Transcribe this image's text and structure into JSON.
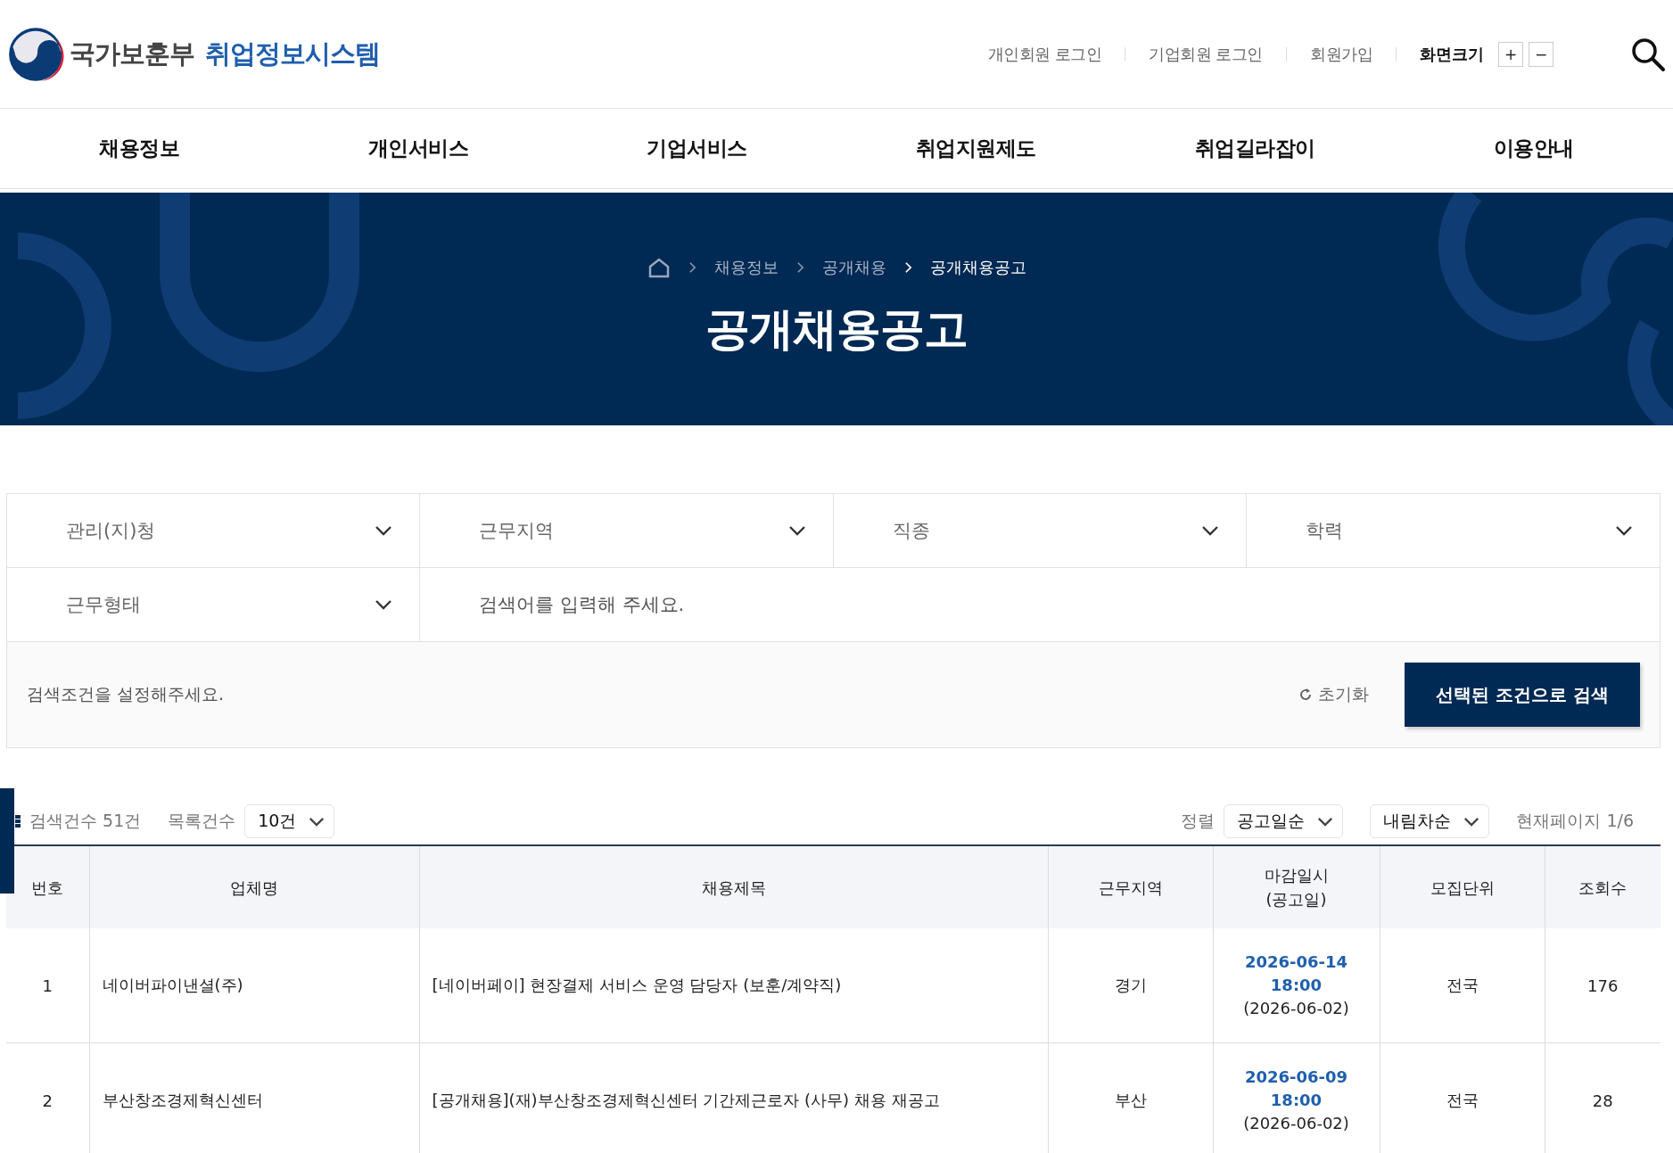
{
  "header": {
    "logo_primary": "국가보훈부",
    "logo_secondary": "취업정보시스템",
    "links": [
      "개인회원 로그인",
      "기업회원 로그인",
      "회원가입"
    ],
    "font_size": {
      "label": "화면크기",
      "increase": "+",
      "decrease": "−"
    }
  },
  "nav": [
    {
      "label": "채용정보",
      "selected": false
    },
    {
      "label": "개인서비스",
      "selected": false
    },
    {
      "label": "기업서비스",
      "selected": false
    },
    {
      "label": "취업지원제도",
      "selected": false
    },
    {
      "label": "취업길라잡이",
      "selected": false
    },
    {
      "label": "이용안내",
      "selected": false
    }
  ],
  "banner": {
    "breadcrumb": [
      "채용정보",
      "공개채용"
    ],
    "current": "공개채용공고",
    "title": "공개채용공고"
  },
  "filters": [
    {
      "kind": "select",
      "label": "관리(지)청"
    },
    {
      "kind": "select",
      "label": "근무지역"
    },
    {
      "kind": "select",
      "label": "직종"
    },
    {
      "kind": "select",
      "label": "학력"
    },
    {
      "kind": "select",
      "label": "근무형태"
    },
    {
      "kind": "input",
      "placeholder": "검색어를 입력해 주세요."
    }
  ],
  "search_bar": {
    "hint": "검색조건을 설정해주세요.",
    "reset": "초기화",
    "submit": "선택된 조건으로 검색"
  },
  "list_toolbar": {
    "count": "검색건수 51건",
    "page_size_label": "목록건수",
    "page_size": "10건",
    "sort_label": "정렬",
    "sort": "공고일순",
    "order": "내림차순",
    "page": "현재페이지 1/6"
  },
  "table": {
    "columns": [
      "번호",
      "업체명",
      "채용제목",
      "근무지역",
      "마감일시\n(공고일)",
      "모집단위",
      "조회수"
    ],
    "rows": [
      {
        "no": "1",
        "company": "네이버파이낸셜(주)",
        "title": "[네이버페이] 현장결제 서비스 운영 담당자 (보훈/계약직)",
        "region": "경기",
        "deadline": "2026-06-14\n18:00",
        "posted": "(2026-06-02)",
        "unit": "전국",
        "views": "176"
      },
      {
        "no": "2",
        "company": "부산창조경제혁신센터",
        "title": "[공개채용](재)부산창조경제혁신센터 기간제근로자 (사무) 채용 재공고",
        "region": "부산",
        "deadline": "2026-06-09\n18:00",
        "posted": "(2026-06-02)",
        "unit": "전국",
        "views": "28"
      }
    ]
  }
}
